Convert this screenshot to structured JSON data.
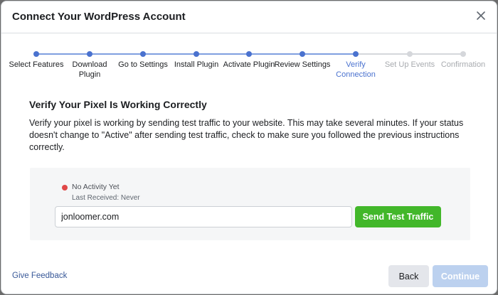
{
  "modal": {
    "title": "Connect Your WordPress Account"
  },
  "colors": {
    "accent": "#4a72cf",
    "complete_line": "#7f9fe0",
    "inactive": "#d5d7db",
    "inactive_label": "#a8abaf",
    "send_button": "#42b72a",
    "status_red": "#e04848",
    "continue_disabled": "#bcd1ef"
  },
  "stepper": {
    "current_index": 6,
    "steps": [
      {
        "label": "Select Features",
        "state": "complete"
      },
      {
        "label": "Download\nPlugin",
        "state": "complete"
      },
      {
        "label": "Go to Settings",
        "state": "complete"
      },
      {
        "label": "Install Plugin",
        "state": "complete"
      },
      {
        "label": "Activate Plugin",
        "state": "complete"
      },
      {
        "label": "Review Settings",
        "state": "complete"
      },
      {
        "label": "Verify\nConnection",
        "state": "current"
      },
      {
        "label": "Set Up Events",
        "state": "upcoming"
      },
      {
        "label": "Confirmation",
        "state": "upcoming"
      }
    ]
  },
  "content": {
    "heading": "Verify Your Pixel Is Working Correctly",
    "description": "Verify your pixel is working by sending test traffic to your website. This may take several minutes. If your status doesn't change to \"Active\" after sending test traffic, check to make sure you followed the previous instructions correctly."
  },
  "status": {
    "text": "No Activity Yet",
    "last_received": "Last Received: Never",
    "icon": "status-dot-red"
  },
  "test": {
    "url_value": "jonloomer.com",
    "send_label": "Send Test Traffic"
  },
  "footer": {
    "feedback_label": "Give Feedback",
    "back_label": "Back",
    "continue_label": "Continue"
  }
}
